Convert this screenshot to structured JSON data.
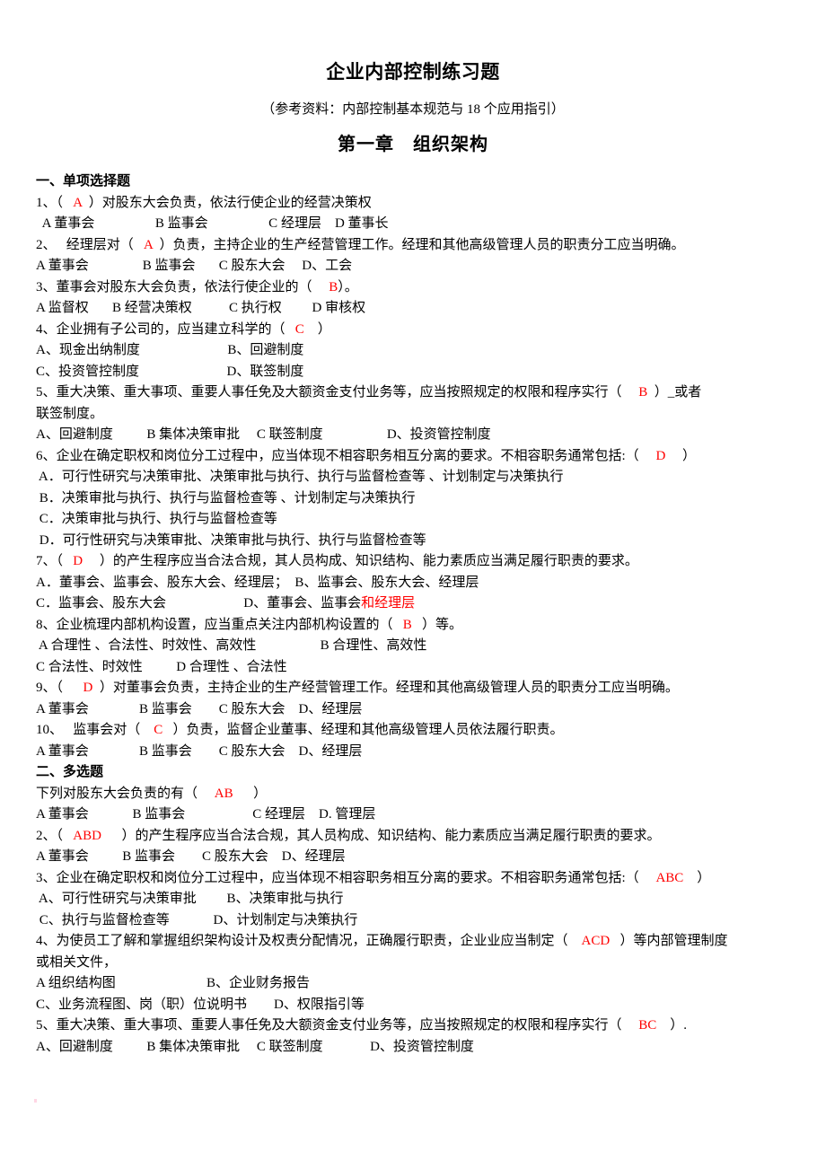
{
  "document": {
    "title": "企业内部控制练习题",
    "subtitle": "（参考资料：内部控制基本规范与 18 个应用指引）",
    "chapter": "第一章　组织架构"
  },
  "section_single": {
    "heading": "一、单项选择题",
    "lines": [
      {
        "id": "q1-stem",
        "pre": "1、（   ",
        "answer": "A",
        "post": "  ）对股东大会负责，依法行使企业的经营决策权"
      },
      {
        "id": "q1-opts",
        "text": "  A 董事会                  B 监事会                  C 经理层    D 董事长"
      },
      {
        "id": "q2-stem",
        "pre": "2、   经理层对（   ",
        "answer": "A",
        "post": "  ）负责，主持企业的生产经营管理工作。经理和其他高级管理人员的职责分工应当明确。"
      },
      {
        "id": "q2-opts",
        "text": "A 董事会                B 监事会       C 股东大会     D、工会"
      },
      {
        "id": "q3-stem",
        "pre": "3、董事会对股东大会负责，依法行使企业的（     ",
        "answer": "B",
        "post": "）。"
      },
      {
        "id": "q3-opts",
        "text": "A 监督权       B 经营决策权           C 执行权         D 审核权"
      },
      {
        "id": "q4-stem",
        "pre": "4、企业拥有子公司的，应当建立科学的（   ",
        "answer": "C",
        "post": "    ）"
      },
      {
        "id": "q4-optsA",
        "text": "A、现金出纳制度                          B、回避制度"
      },
      {
        "id": "q4-optsC",
        "text": "C、投资管控制度                          D、联签制度"
      },
      {
        "id": "q5-stem1",
        "pre": "5、重大决策、重大事项、重要人事任免及大额资金支付业务等，应当按照规定的权限和程序实行（     ",
        "answer": "B",
        "post": "  ）_或者"
      },
      {
        "id": "q5-stem2",
        "text": "联签制度。"
      },
      {
        "id": "q5-opts",
        "text": "A、回避制度          B 集体决策审批     C 联签制度                   D、投资管控制度"
      },
      {
        "id": "q6-stem",
        "pre": "6、企业在确定职权和岗位分工过程中，应当体现不相容职务相互分离的要求。不相容职务通常包括:（     ",
        "answer": "D",
        "post": "     ）"
      },
      {
        "id": "q6-optA",
        "text": " A．可行性研究与决策审批、决策审批与执行、执行与监督检查等 、计划制定与决策执行"
      },
      {
        "id": "q6-optB",
        "text": " B．决策审批与执行、执行与监督检查等 、计划制定与决策执行"
      },
      {
        "id": "q6-optC",
        "text": " C．决策审批与执行、执行与监督检查等"
      },
      {
        "id": "q6-optD",
        "text": " D．可行性研究与决策审批、决策审批与执行、执行与监督检查等"
      },
      {
        "id": "q7-stem",
        "pre": "7、（   ",
        "answer": "D",
        "post": "     ）的产生程序应当合法合规，其人员构成、知识结构、能力素质应当满足履行职责的要求。"
      },
      {
        "id": "q7-optAB",
        "text": "A．董事会、监事会、股东大会、经理层；  B、监事会、股东大会、经理层"
      },
      {
        "id": "q7-optCD",
        "text": "C．监事会、股东大会                       D、董事会、监事会",
        "red_tail": "和经理层"
      },
      {
        "id": "q8-stem",
        "pre": "8、企业梳理内部机构设置，应当重点关注内部机构设置的（   ",
        "answer": "B",
        "post": "   ）等。"
      },
      {
        "id": "q8-optAB",
        "text": " A 合理性 、合法性、时效性、高效性                   B 合理性、高效性"
      },
      {
        "id": "q8-optCD",
        "text": "C 合法性、时效性          D 合理性 、合法性"
      },
      {
        "id": "q9-stem",
        "pre": "9、（      ",
        "answer": "D",
        "post": "  ）对董事会负责，主持企业的生产经营管理工作。经理和其他高级管理人员的职责分工应当明确。"
      },
      {
        "id": "q9-opts",
        "text": "A 董事会               B 监事会        C 股东大会    D、经理层"
      },
      {
        "id": "q10-stem",
        "pre": "10、   监事会对（    ",
        "answer": "C",
        "post": "   ）负责，监督企业董事、经理和其他高级管理人员依法履行职责。"
      },
      {
        "id": "q10-opts",
        "text": "A 董事会               B 监事会        C 股东大会    D、经理层"
      }
    ]
  },
  "section_multi": {
    "heading": "二、多选题",
    "lines": [
      {
        "id": "m1-stem",
        "pre": "下列对股东大会负责的有（     ",
        "answer": "AB",
        "post": "      ）"
      },
      {
        "id": "m1-opts",
        "text": "A 董事会             B 监事会                    C 经理层    D. 管理层"
      },
      {
        "id": "m2-stem",
        "pre": "2、（   ",
        "answer": "ABD",
        "post": "      ）的产生程序应当合法合规，其人员构成、知识结构、能力素质应当满足履行职责的要求。"
      },
      {
        "id": "m2-opts",
        "text": "A 董事会          B 监事会        C 股东大会    D、经理层"
      },
      {
        "id": "m3-stem",
        "pre": "3、企业在确定职权和岗位分工过程中，应当体现不相容职务相互分离的要求。不相容职务通常包括:（     ",
        "answer": "ABC",
        "post": "    ）"
      },
      {
        "id": "m3-optAB",
        "text": " A、可行性研究与决策审批         B、决策审批与执行"
      },
      {
        "id": "m3-optCD",
        "text": " C、执行与监督检查等             D、计划制定与决策执行"
      },
      {
        "id": "m4-stem1",
        "pre": "4、为使员工了解和掌握组织架构设计及权责分配情况，正确履行职责，企业业应当制定（    ",
        "answer": "ACD",
        "post": "   ）等内部管理制度"
      },
      {
        "id": "m4-stem2",
        "text": "或相关文件，"
      },
      {
        "id": "m4-optAB",
        "text": "A 组织结构图                           B、企业财务报告"
      },
      {
        "id": "m4-optCD",
        "text": "C、业务流程图、岗（职）位说明书        D、权限指引等"
      },
      {
        "id": "m5-stem",
        "pre": "5、重大决策、重大事项、重要人事任免及大额资金支付业务等，应当按照规定的权限和程序实行（     ",
        "answer": "BC",
        "post": "    ）."
      },
      {
        "id": "m5-opts",
        "text": "A、回避制度          B 集体决策审批     C 联签制度              D、投资管控制度"
      }
    ]
  },
  "colors": {
    "answer_red": "#FF0000",
    "text_black": "#000000",
    "page_background": "#FFFFFF"
  }
}
